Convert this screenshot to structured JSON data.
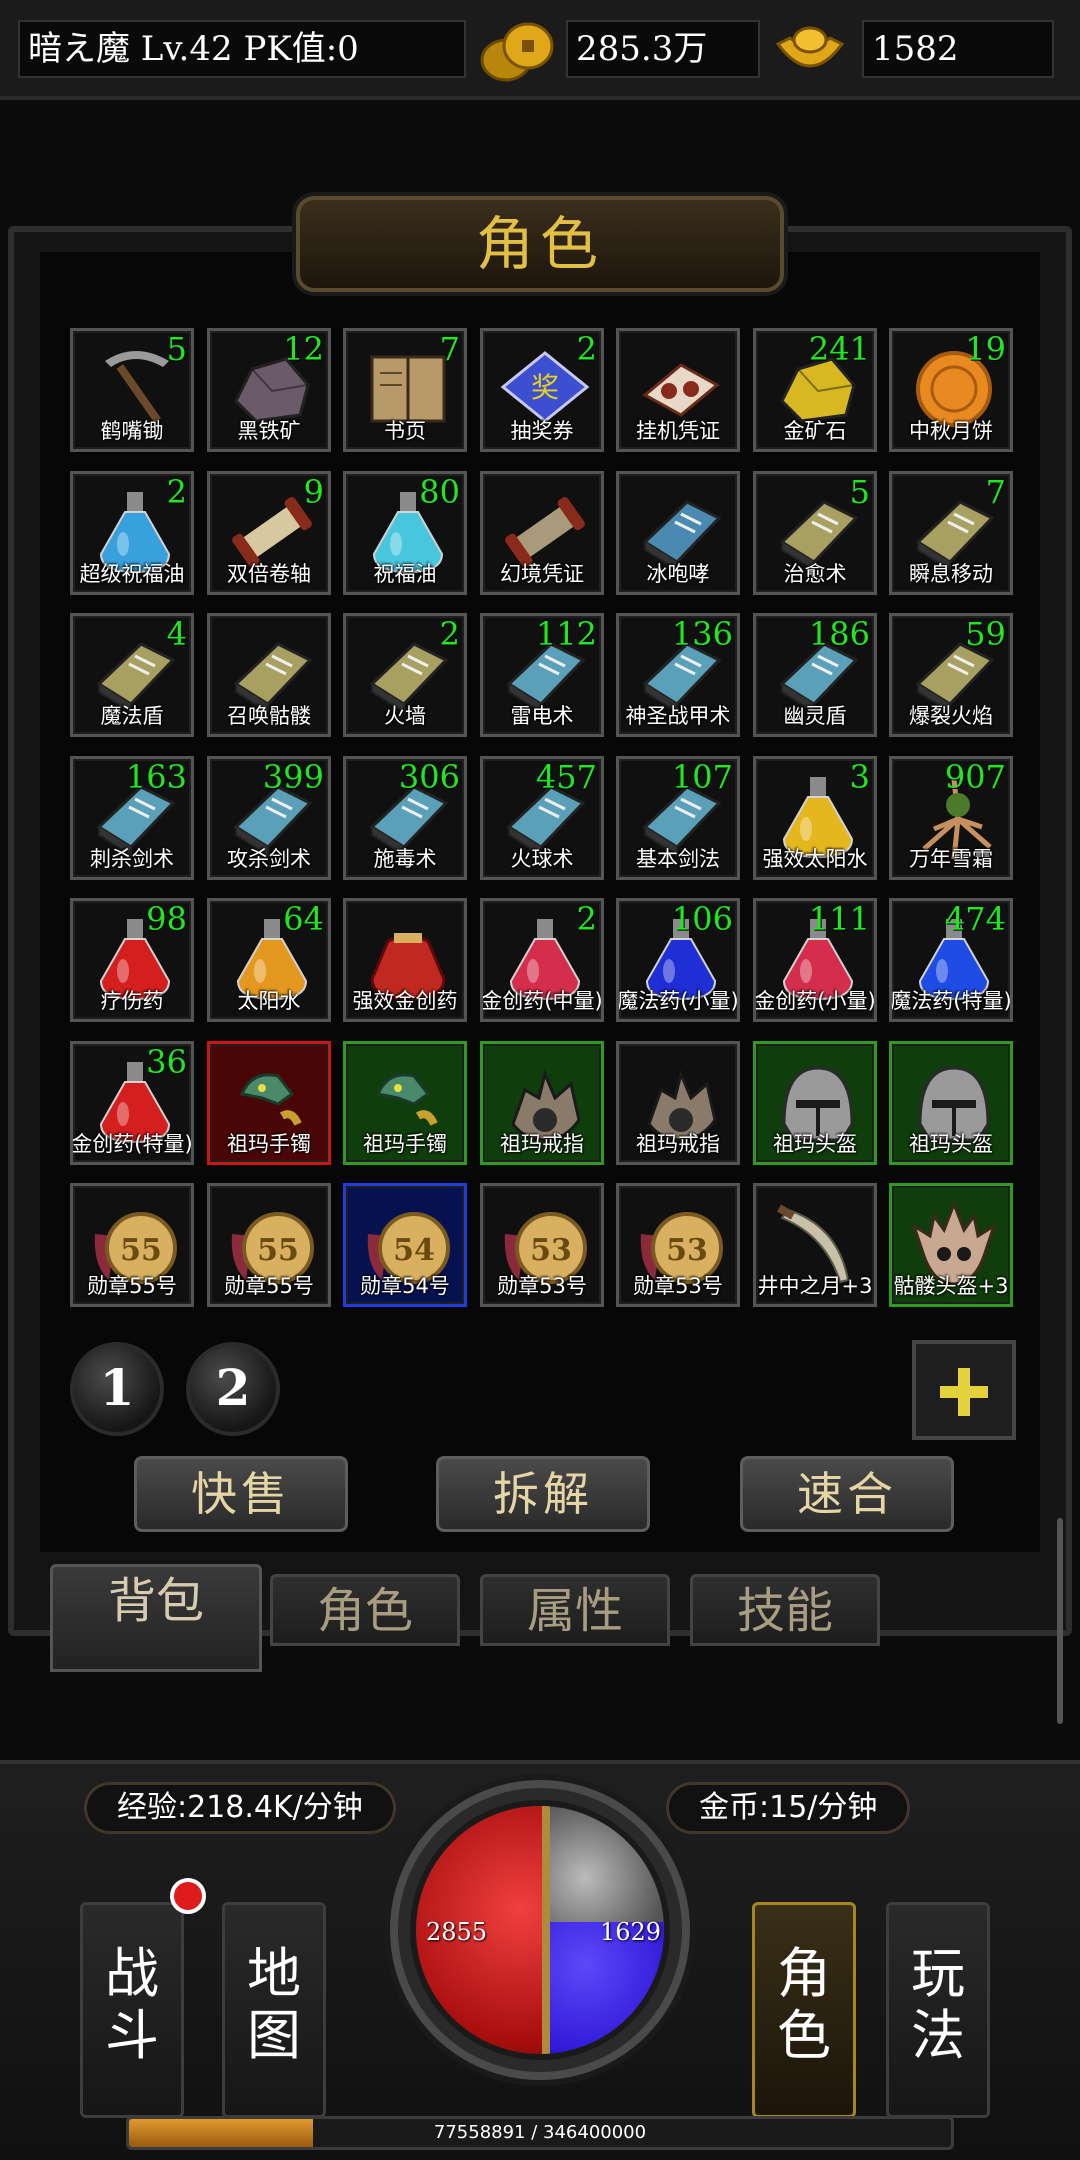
{
  "topbar": {
    "player": "暗え魔  Lv.42 PK值:0",
    "gold_amount": "285.3万",
    "ingot_amount": "1582",
    "gold_icon": "gold-coins-icon",
    "ingot_icon": "gold-ingot-icon"
  },
  "panel": {
    "title": "角色"
  },
  "items": [
    {
      "name": "鹤嘴锄",
      "count": "5",
      "icon": "pickaxe-icon",
      "rarity": "normal",
      "color": "#9a9a9a"
    },
    {
      "name": "黑铁矿",
      "count": "12",
      "icon": "ore-icon",
      "rarity": "normal",
      "color": "#6a5a6a"
    },
    {
      "name": "书页",
      "count": "7",
      "icon": "book-icon",
      "rarity": "normal",
      "color": "#b89a6a"
    },
    {
      "name": "抽奖券",
      "count": "2",
      "icon": "ticket-icon",
      "rarity": "normal",
      "color": "#3b4fd0"
    },
    {
      "name": "挂机凭证",
      "count": "",
      "icon": "voucher-icon",
      "rarity": "normal",
      "color": "#e8d8c8"
    },
    {
      "name": "金矿石",
      "count": "241",
      "icon": "ore-icon",
      "rarity": "normal",
      "color": "#d8b820"
    },
    {
      "name": "中秋月饼",
      "count": "19",
      "icon": "mooncake-icon",
      "rarity": "normal",
      "color": "#e88a20"
    },
    {
      "name": "超级祝福油",
      "count": "2",
      "icon": "flask-icon",
      "rarity": "normal",
      "color": "#3aa8e8"
    },
    {
      "name": "双倍卷轴",
      "count": "9",
      "icon": "scroll-icon",
      "rarity": "normal",
      "color": "#d8c8a0"
    },
    {
      "name": "祝福油",
      "count": "80",
      "icon": "flask-icon",
      "rarity": "normal",
      "color": "#4ad0e8"
    },
    {
      "name": "幻境凭证",
      "count": "",
      "icon": "scroll-icon",
      "rarity": "normal",
      "color": "#a89a7a"
    },
    {
      "name": "冰咆哮",
      "count": "",
      "icon": "skill-book-icon",
      "rarity": "normal",
      "color": "#4a8ab0"
    },
    {
      "name": "治愈术",
      "count": "5",
      "icon": "skill-book-icon",
      "rarity": "normal",
      "color": "#a8a060"
    },
    {
      "name": "瞬息移动",
      "count": "7",
      "icon": "skill-book-icon",
      "rarity": "normal",
      "color": "#a8a060"
    },
    {
      "name": "魔法盾",
      "count": "4",
      "icon": "skill-book-icon",
      "rarity": "normal",
      "color": "#a8a060"
    },
    {
      "name": "召唤骷髅",
      "count": "",
      "icon": "skill-book-icon",
      "rarity": "normal",
      "color": "#a8a060"
    },
    {
      "name": "火墙",
      "count": "2",
      "icon": "skill-book-icon",
      "rarity": "normal",
      "color": "#a8a060"
    },
    {
      "name": "雷电术",
      "count": "112",
      "icon": "skill-book-icon",
      "rarity": "normal",
      "color": "#5aa0b8"
    },
    {
      "name": "神圣战甲术",
      "count": "136",
      "icon": "skill-book-icon",
      "rarity": "normal",
      "color": "#5aa0b8"
    },
    {
      "name": "幽灵盾",
      "count": "186",
      "icon": "skill-book-icon",
      "rarity": "normal",
      "color": "#5aa0b8"
    },
    {
      "name": "爆裂火焰",
      "count": "59",
      "icon": "skill-book-icon",
      "rarity": "normal",
      "color": "#a8a060"
    },
    {
      "name": "刺杀剑术",
      "count": "163",
      "icon": "skill-book-icon",
      "rarity": "normal",
      "color": "#5aa0b8"
    },
    {
      "name": "攻杀剑术",
      "count": "399",
      "icon": "skill-book-icon",
      "rarity": "normal",
      "color": "#5aa0b8"
    },
    {
      "name": "施毒术",
      "count": "306",
      "icon": "skill-book-icon",
      "rarity": "normal",
      "color": "#5aa0b8"
    },
    {
      "name": "火球术",
      "count": "457",
      "icon": "skill-book-icon",
      "rarity": "normal",
      "color": "#5aa0b8"
    },
    {
      "name": "基本剑法",
      "count": "107",
      "icon": "skill-book-icon",
      "rarity": "normal",
      "color": "#5aa0b8"
    },
    {
      "name": "强效太阳水",
      "count": "3",
      "icon": "flask-icon",
      "rarity": "normal",
      "color": "#f0c020"
    },
    {
      "name": "万年雪霜",
      "count": "907",
      "icon": "root-icon",
      "rarity": "normal",
      "color": "#c89060"
    },
    {
      "name": "疗伤药",
      "count": "98",
      "icon": "flask-icon",
      "rarity": "normal",
      "color": "#e02020"
    },
    {
      "name": "太阳水",
      "count": "64",
      "icon": "flask-icon",
      "rarity": "normal",
      "color": "#f0a020"
    },
    {
      "name": "强效金创药",
      "count": "",
      "icon": "pouch-icon",
      "rarity": "normal",
      "color": "#c02820"
    },
    {
      "name": "金创药(中量)",
      "count": "2",
      "icon": "flask-icon",
      "rarity": "normal",
      "color": "#e03050"
    },
    {
      "name": "魔法药(小量)",
      "count": "106",
      "icon": "flask-icon",
      "rarity": "normal",
      "color": "#2030e0"
    },
    {
      "name": "金创药(小量)",
      "count": "111",
      "icon": "flask-icon",
      "rarity": "normal",
      "color": "#e03050"
    },
    {
      "name": "魔法药(特量)",
      "count": "474",
      "icon": "flask-icon",
      "rarity": "normal",
      "color": "#2050f0"
    },
    {
      "name": "金创药(特量)",
      "count": "36",
      "icon": "flask-icon",
      "rarity": "normal",
      "color": "#e02020"
    },
    {
      "name": "祖玛手镯",
      "count": "",
      "icon": "bracelet-icon",
      "rarity": "red",
      "color": "#4a8a6a"
    },
    {
      "name": "祖玛手镯",
      "count": "",
      "icon": "bracelet-icon",
      "rarity": "green",
      "color": "#4a8a6a"
    },
    {
      "name": "祖玛戒指",
      "count": "",
      "icon": "ring-icon",
      "rarity": "green",
      "color": "#8a7a6a"
    },
    {
      "name": "祖玛戒指",
      "count": "",
      "icon": "ring-icon",
      "rarity": "normal",
      "color": "#8a7a6a"
    },
    {
      "name": "祖玛头盔",
      "count": "",
      "icon": "helmet-icon",
      "rarity": "green",
      "color": "#9a9a9a"
    },
    {
      "name": "祖玛头盔",
      "count": "",
      "icon": "helmet-icon",
      "rarity": "green",
      "color": "#9a9a9a"
    },
    {
      "name": "勋章55号",
      "count": "",
      "icon": "medal-icon",
      "rarity": "normal",
      "color": "#d8b060",
      "medal": "55"
    },
    {
      "name": "勋章55号",
      "count": "",
      "icon": "medal-icon",
      "rarity": "normal",
      "color": "#d8b060",
      "medal": "55"
    },
    {
      "name": "勋章54号",
      "count": "",
      "icon": "medal-icon",
      "rarity": "blue",
      "color": "#d8b060",
      "medal": "54"
    },
    {
      "name": "勋章53号",
      "count": "",
      "icon": "medal-icon",
      "rarity": "normal",
      "color": "#d8b060",
      "medal": "53"
    },
    {
      "name": "勋章53号",
      "count": "",
      "icon": "medal-icon",
      "rarity": "normal",
      "color": "#d8b060",
      "medal": "53"
    },
    {
      "name": "井中之月+3",
      "count": "",
      "icon": "sword-icon",
      "rarity": "normal",
      "color": "#c8c0a8"
    },
    {
      "name": "骷髅头盔+3",
      "count": "",
      "icon": "skull-helmet-icon",
      "rarity": "green",
      "color": "#c8a890"
    }
  ],
  "pages": [
    "1",
    "2"
  ],
  "actions": {
    "quick_sell": "快售",
    "dismantle": "拆解",
    "combine": "速合"
  },
  "tabs": {
    "bag": "背包",
    "role": "角色",
    "attr": "属性",
    "skill": "技能"
  },
  "hud": {
    "exp_rate": "经验:218.4K/分钟",
    "gold_rate": "金币:15/分钟",
    "hp": "2855",
    "mp": "1629",
    "battle": "战\n斗",
    "map": "地\n图",
    "character": "角\n色",
    "gameplay": "玩\n法",
    "exp_text": "77558891 / 346400000",
    "exp_current": 77558891,
    "exp_total": 346400000
  }
}
